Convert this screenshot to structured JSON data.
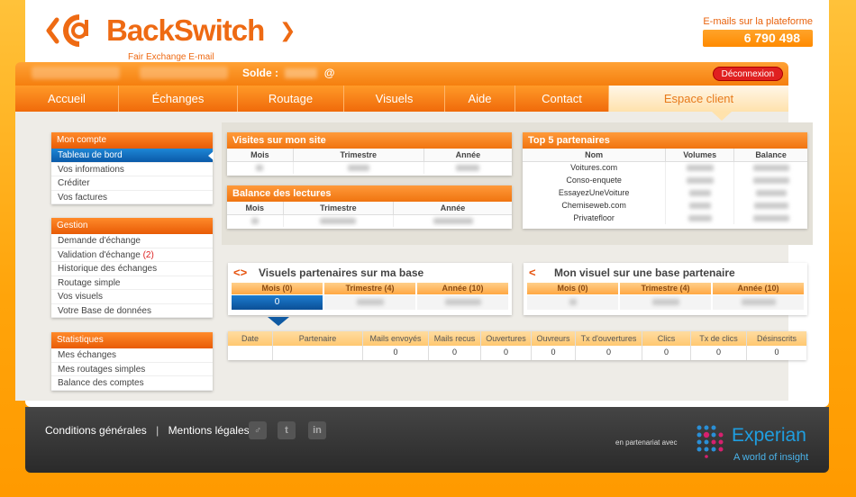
{
  "brand": {
    "name": "BackSwitch",
    "tagline": "Fair Exchange E-mail",
    "color": "#ee6a13"
  },
  "emails": {
    "label": "E-mails sur la plateforme",
    "count": "6 790 498"
  },
  "userbar": {
    "solde_label": "Solde :",
    "solde_suffix": "@",
    "logout_label": "Déconnexion"
  },
  "nav": {
    "items": [
      "Accueil",
      "Échanges",
      "Routage",
      "Visuels",
      "Aide",
      "Contact",
      "Espace client"
    ],
    "active": "Espace client"
  },
  "sidebar": {
    "compte": {
      "title": "Mon compte",
      "items": [
        "Tableau de bord",
        "Vos informations",
        "Créditer",
        "Vos factures"
      ]
    },
    "gestion": {
      "title": "Gestion",
      "items": [
        "Demande d'échange",
        "Validation d'échange",
        "Historique des échanges",
        "Routage simple",
        "Vos visuels",
        "Votre Base de données"
      ],
      "validation_count": "(2)"
    },
    "stats": {
      "title": "Statistiques",
      "items": [
        "Mes échanges",
        "Mes routages simples",
        "Balance des comptes"
      ]
    }
  },
  "visites": {
    "title": "Visites sur mon site",
    "columns": [
      "Mois",
      "Trimestre",
      "Année"
    ]
  },
  "balance_lectures": {
    "title": "Balance des lectures",
    "columns": [
      "Mois",
      "Trimestre",
      "Année"
    ]
  },
  "top5": {
    "title": "Top 5 partenaires",
    "columns": [
      "Nom",
      "Volumes",
      "Balance"
    ],
    "rows": [
      "Voitures.com",
      "Conso-enquete",
      "EssayezUneVoiture",
      "Chemiseweb.com",
      "Privatefloor"
    ]
  },
  "visuels_base": {
    "title": "Visuels partenaires sur ma base",
    "columns": [
      "Mois (0)",
      "Trimestre (4)",
      "Année (10)"
    ],
    "month_value": "0"
  },
  "mon_visuel": {
    "title": "Mon visuel sur une base partenaire",
    "columns": [
      "Mois (0)",
      "Trimestre (4)",
      "Année (10)"
    ]
  },
  "stats_table": {
    "columns": [
      "Date",
      "Partenaire",
      "Mails envoyés",
      "Mails recus",
      "Ouvertures",
      "Ouvreurs",
      "Tx d'ouvertures",
      "Clics",
      "Tx de clics",
      "Désinscrits"
    ],
    "values": [
      "",
      "",
      "0",
      "0",
      "0",
      "0",
      "0",
      "0",
      "0",
      "0"
    ]
  },
  "footer": {
    "conditions": "Conditions générales",
    "separator": "|",
    "mentions": "Mentions légales",
    "social_icons": [
      "myspace-icon",
      "twitter-icon",
      "linkedin-icon"
    ],
    "partner_label": "en partenariat avec",
    "partner_name": "Experian",
    "partner_tagline": "A world of insight"
  }
}
